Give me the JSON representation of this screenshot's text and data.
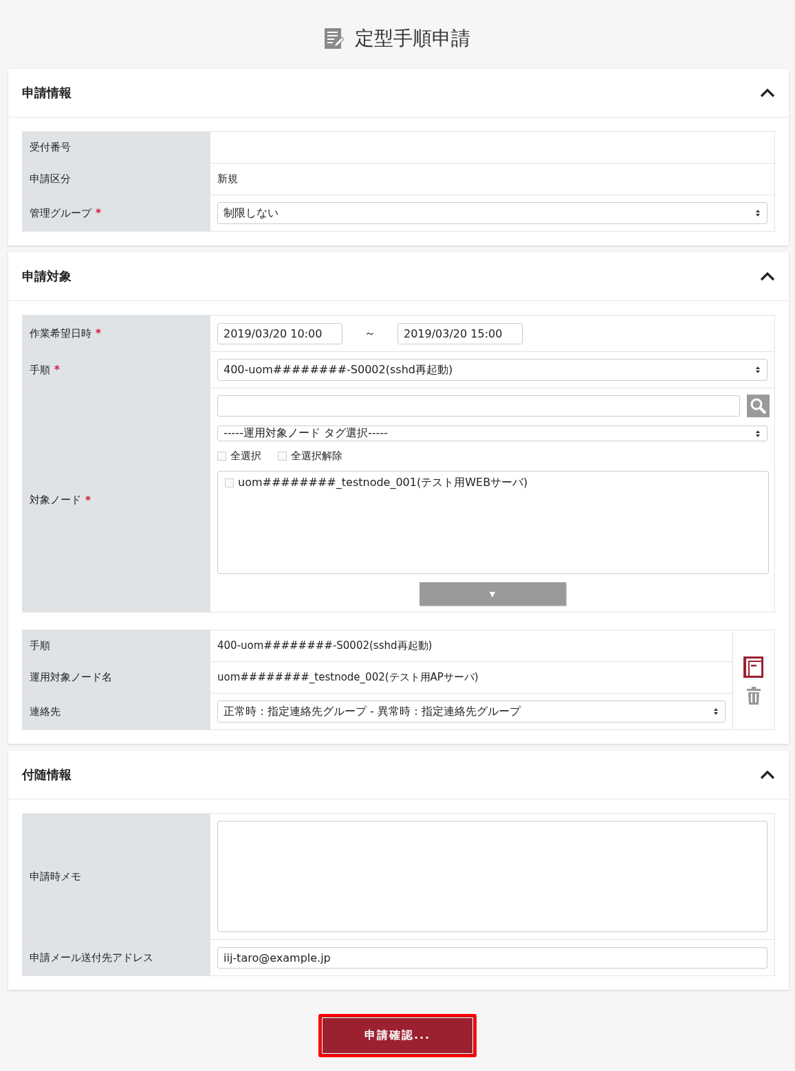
{
  "title": "定型手順申請",
  "required_mark": "*",
  "sections": [
    {
      "title": "申請情報",
      "tables": [
        {
          "actions": false,
          "rows": [
            {
              "label": "受付番号",
              "required": false,
              "kind": "text"
            },
            {
              "label": "申請区分",
              "required": false,
              "kind": "text",
              "value": "新規"
            },
            {
              "label": "管理グループ",
              "required": true,
              "kind": "select",
              "value": "制限しない"
            }
          ]
        }
      ]
    },
    {
      "title": "申請対象",
      "tables": [
        {
          "actions": false,
          "rows": [
            {
              "label": "作業希望日時",
              "required": true,
              "kind": "daterange",
              "from": "2019/03/20 10:00",
              "separator": "～",
              "to": "2019/03/20 15:00"
            },
            {
              "label": "手順",
              "required": true,
              "kind": "select",
              "value": "400-uom########-S0002(sshd再起動)"
            },
            {
              "label": "対象ノード",
              "required": true,
              "kind": "nodes",
              "tag_select": "-----運用対象ノード タグ選択-----",
              "bulk": [
                {
                  "label": "全選択",
                  "checked": false
                },
                {
                  "label": "全選択解除",
                  "checked": false
                }
              ],
              "nodes": [
                {
                  "label": "uom########_testnode_001(テスト用WEBサーバ)",
                  "checked": false
                }
              ],
              "add_button": "▼"
            }
          ]
        },
        {
          "actions": true,
          "rows": [
            {
              "label": "手順",
              "required": false,
              "kind": "text",
              "value": "400-uom########-S0002(sshd再起動)"
            },
            {
              "label": "運用対象ノード名",
              "required": false,
              "kind": "text",
              "value": "uom########_testnode_002(テスト用APサーバ)"
            },
            {
              "label": "連絡先",
              "required": false,
              "kind": "select",
              "value": "正常時：指定連絡先グループ - 異常時：指定連絡先グループ"
            }
          ]
        }
      ]
    },
    {
      "title": "付随情報",
      "tables": [
        {
          "actions": false,
          "rows": [
            {
              "label": "申請時メモ",
              "required": false,
              "kind": "textarea"
            },
            {
              "label": "申請メール送付先アドレス",
              "required": false,
              "kind": "input",
              "value": "iij-taro@example.jp"
            }
          ]
        }
      ]
    }
  ],
  "submit": "申請確認..."
}
